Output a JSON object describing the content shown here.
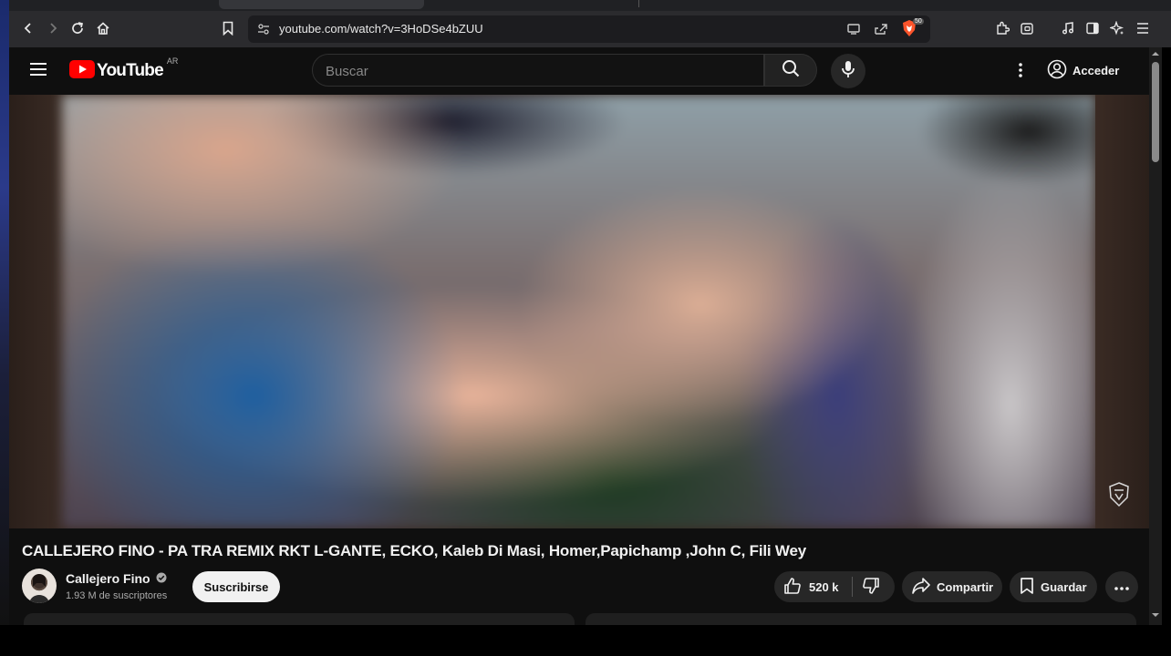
{
  "browser": {
    "url": "youtube.com/watch?v=3HoDSe4bZUU",
    "shield_count": "50"
  },
  "youtube": {
    "logo_text": "YouTube",
    "region": "AR",
    "search_placeholder": "Buscar",
    "signin_label": "Acceder"
  },
  "video": {
    "title": "CALLEJERO FINO - PA TRA REMIX RKT L-GANTE, ECKO, Kaleb Di Masi, Homer,Papichamp ,John C, Fili Wey"
  },
  "channel": {
    "name": "Callejero Fino",
    "subscribers": "1.93 M de suscriptores",
    "subscribe_label": "Suscribirse"
  },
  "actions": {
    "likes": "520 k",
    "share_label": "Compartir",
    "save_label": "Guardar"
  },
  "colors": {
    "brand_red": "#ff0000",
    "page_bg": "#0f0f0f",
    "pill_bg": "#272727"
  }
}
